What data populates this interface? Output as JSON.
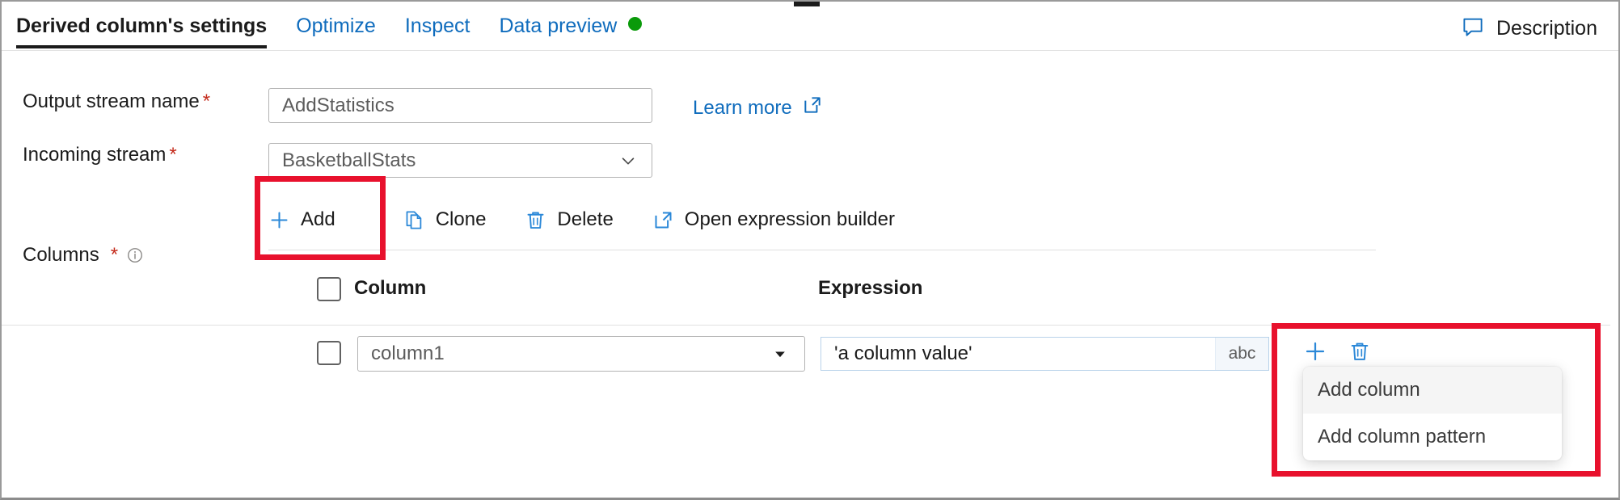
{
  "window": {
    "drag_grip": "drag-grip"
  },
  "tabs": [
    {
      "label": "Derived column's settings",
      "active": true
    },
    {
      "label": "Optimize",
      "active": false
    },
    {
      "label": "Inspect",
      "active": false
    },
    {
      "label": "Data preview",
      "active": false,
      "status_dot_color": "#0a9a0a"
    }
  ],
  "header": {
    "description_label": "Description",
    "description_icon": "comment-icon"
  },
  "form": {
    "output_stream": {
      "label": "Output stream name",
      "required_marker": "*",
      "value": "AddStatistics"
    },
    "incoming_stream": {
      "label": "Incoming stream",
      "required_marker": "*",
      "value": "BasketballStats",
      "caret_icon": "chevron-down-icon"
    },
    "learn_more": {
      "label": "Learn more",
      "icon": "external-link-icon"
    },
    "columns": {
      "label": "Columns",
      "required_marker": "*",
      "info_icon": "info-icon"
    }
  },
  "commandbar": [
    {
      "label": "Add",
      "icon": "plus-icon"
    },
    {
      "label": "Clone",
      "icon": "copy-icon"
    },
    {
      "label": "Delete",
      "icon": "trash-icon"
    },
    {
      "label": "Open expression builder",
      "icon": "external-link-icon"
    }
  ],
  "grid": {
    "headers": {
      "select_all": "select-all-checkbox",
      "column": "Column",
      "expression": "Expression"
    },
    "rows": [
      {
        "selected": false,
        "column_value": "column1",
        "column_caret": "chevron-down-icon",
        "expression_value": "'a column value'",
        "expression_type": "abc",
        "actions": [
          {
            "icon": "plus-icon",
            "name": "add-row-button"
          },
          {
            "icon": "trash-icon",
            "name": "delete-row-button"
          }
        ]
      }
    ]
  },
  "context_menu": {
    "items": [
      {
        "label": "Add column",
        "hovered": true
      },
      {
        "label": "Add column pattern",
        "hovered": false
      }
    ]
  },
  "annotations": {
    "highlight_color": "#e8112d",
    "boxes": [
      {
        "name": "add-button-highlight"
      },
      {
        "name": "add-column-menu-highlight"
      }
    ]
  }
}
